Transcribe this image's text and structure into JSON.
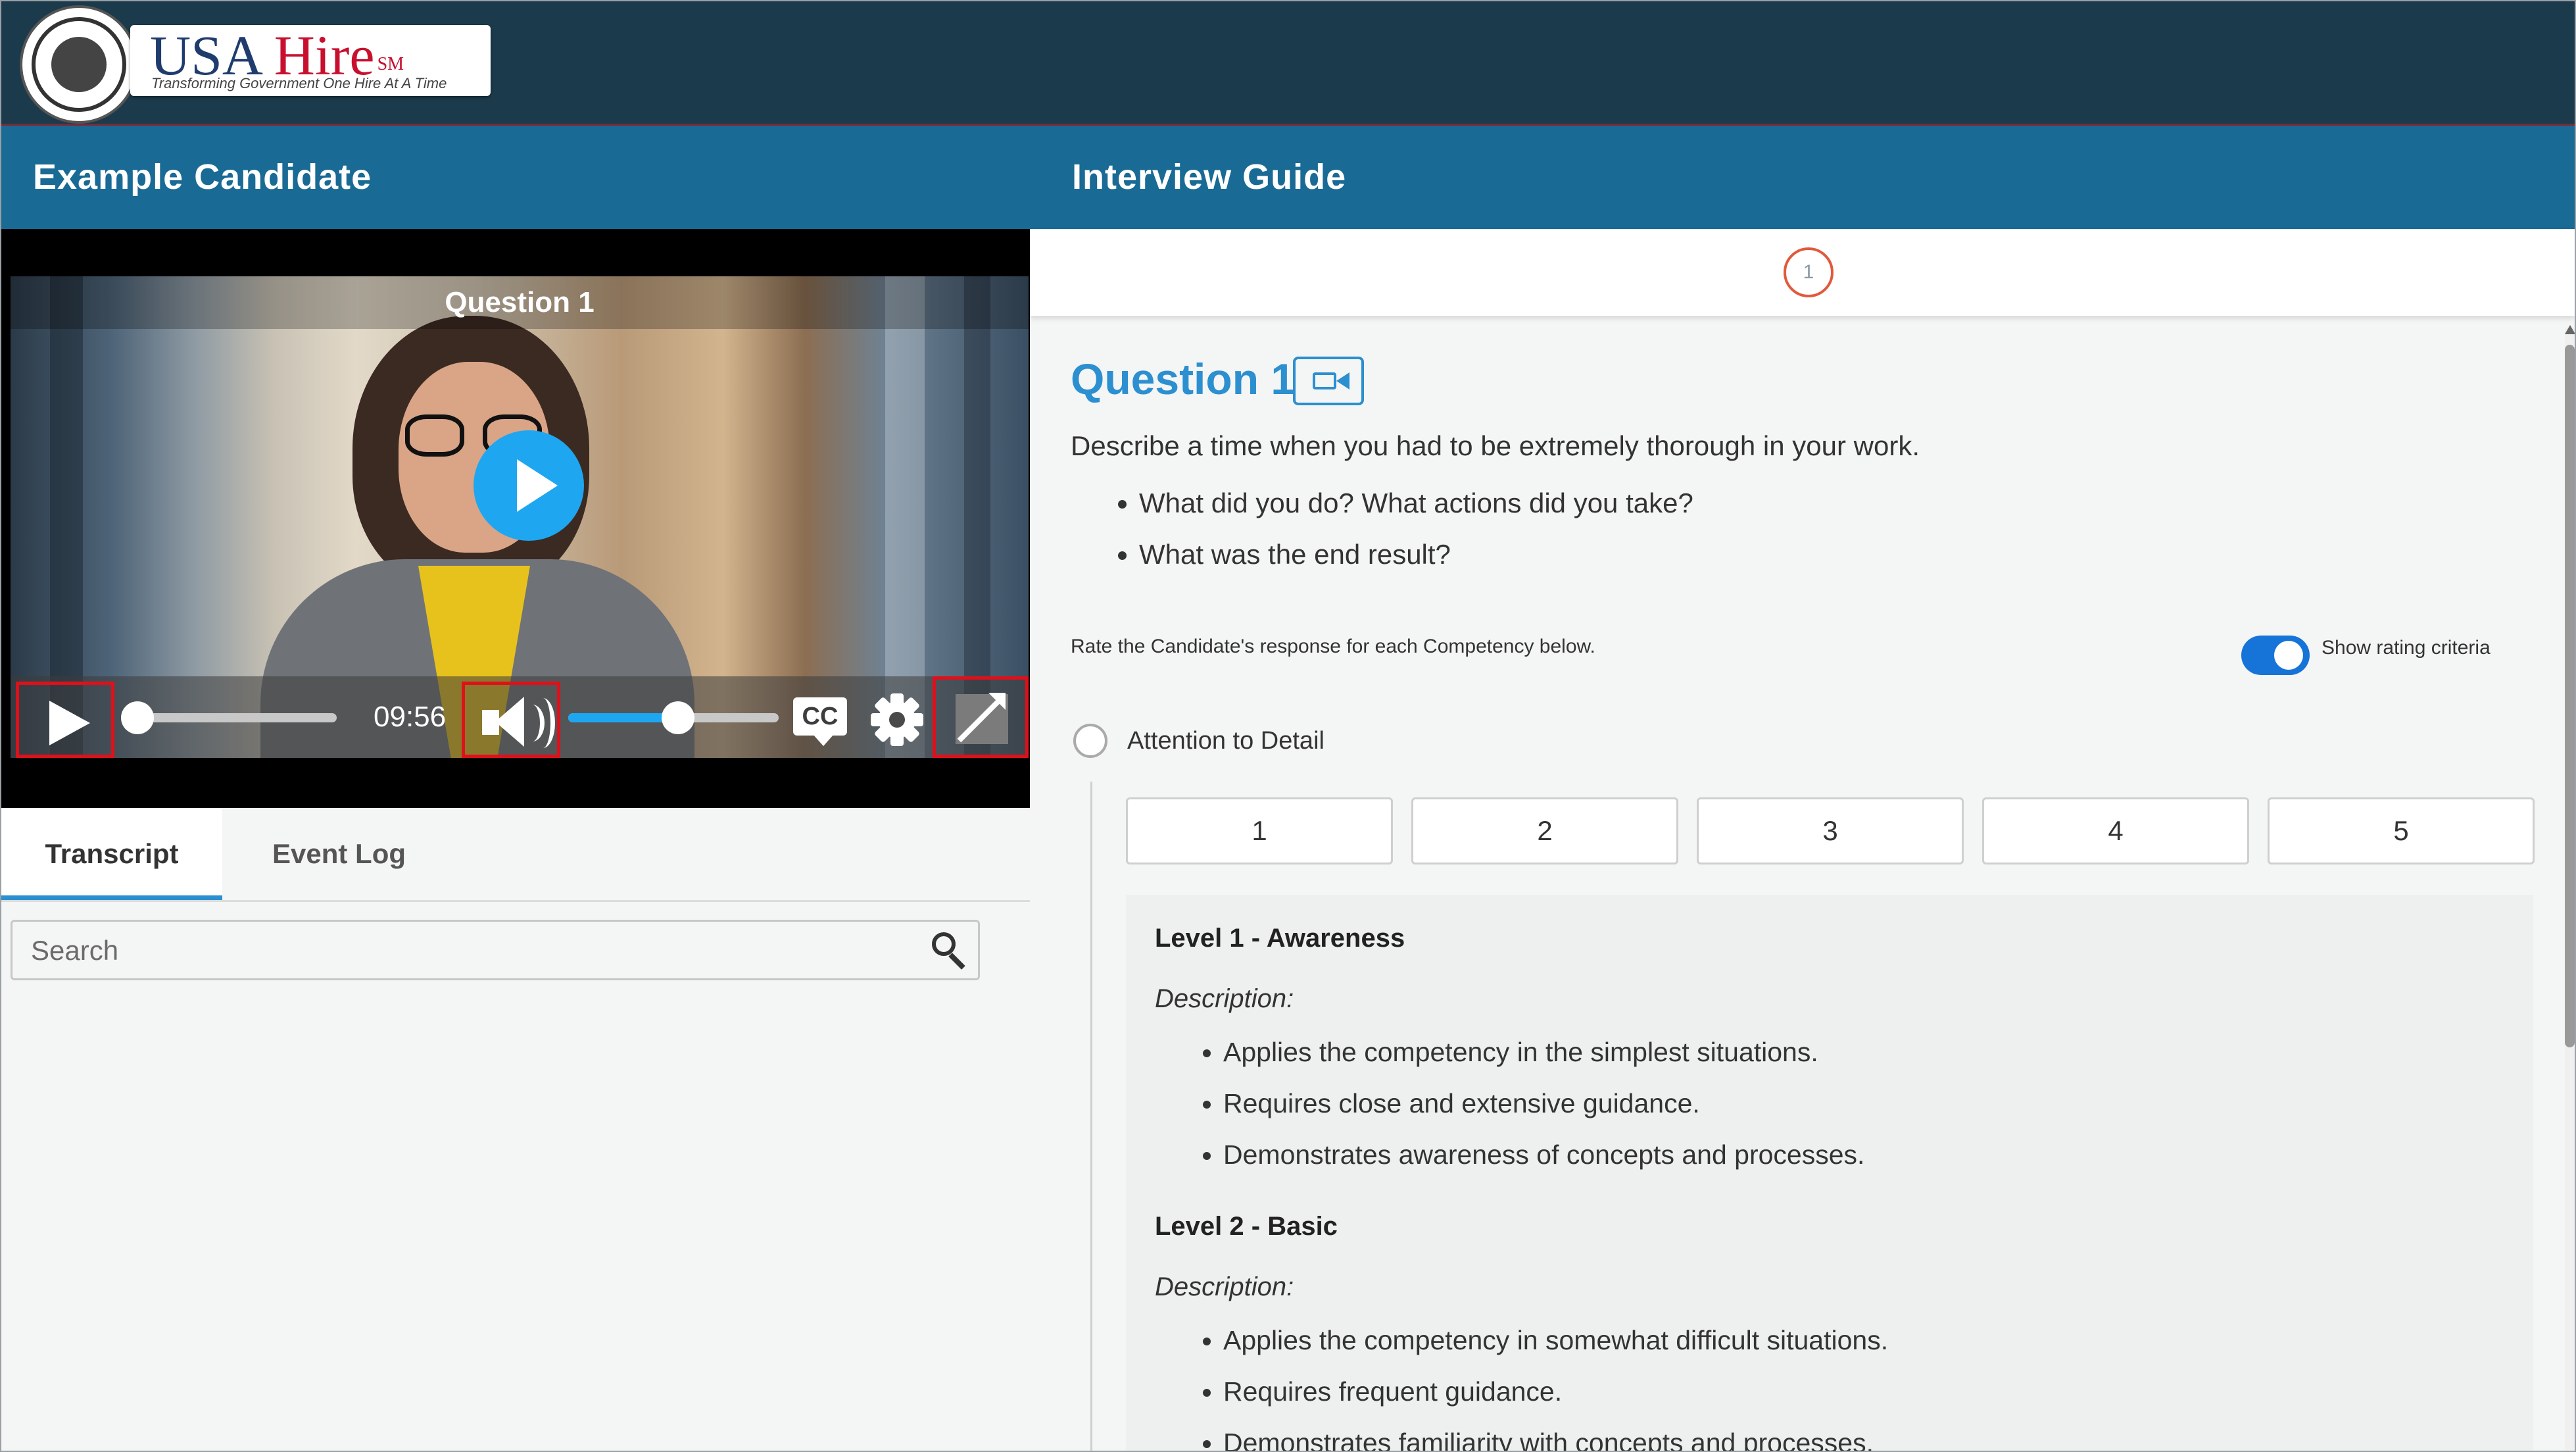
{
  "app": {
    "logo_text_usa": "USA",
    "logo_text_hire": "Hire",
    "logo_mark": "SM",
    "logo_tagline": "Transforming Government One Hire At A Time"
  },
  "left_header": {
    "title": "Example Candidate"
  },
  "right_header": {
    "title": "Interview Guide"
  },
  "video": {
    "title": "Question 1",
    "time": "09:56",
    "cc_label": "CC",
    "seek_progress": 0.0,
    "volume_level": 0.5
  },
  "tabs": [
    {
      "label": "Transcript",
      "active": true
    },
    {
      "label": "Event Log",
      "active": false
    }
  ],
  "search": {
    "placeholder": "Search",
    "value": ""
  },
  "stepper": {
    "current_step": "1"
  },
  "question": {
    "title": "Question 1",
    "text": "Describe a time when you had to be extremely thorough in your work.",
    "prompts": [
      "What did you do? What actions did you take?",
      "What was the end result?"
    ],
    "rate_instruction": "Rate the Candidate's response for each Competency below.",
    "toggle_label": "Show rating criteria",
    "toggle_on": true
  },
  "competency": {
    "name": "Attention to Detail",
    "ratings": [
      "1",
      "2",
      "3",
      "4",
      "5"
    ],
    "levels": [
      {
        "title": "Level 1 - Awareness",
        "description_label": "Description:",
        "items": [
          "Applies the competency in the simplest situations.",
          "Requires close and extensive guidance.",
          "Demonstrates awareness of concepts and processes."
        ]
      },
      {
        "title": "Level 2 - Basic",
        "description_label": "Description:",
        "items": [
          "Applies the competency in somewhat difficult situations.",
          "Requires frequent guidance.",
          "Demonstrates familiarity with concepts and processes."
        ]
      }
    ]
  },
  "colors": {
    "top_bar": "#1b3a4b",
    "header": "#196a94",
    "accent": "#2c8fd0",
    "play": "#1ea7f0",
    "highlight": "#e0101a",
    "toggle": "#1673d8",
    "step_ring": "#e05a3c"
  },
  "icons": {
    "play": "play-icon",
    "volume": "volume-icon",
    "closed_captions": "cc-icon",
    "settings": "gear-icon",
    "popout": "popout-icon",
    "search": "search-icon",
    "camera": "video-camera-icon"
  }
}
